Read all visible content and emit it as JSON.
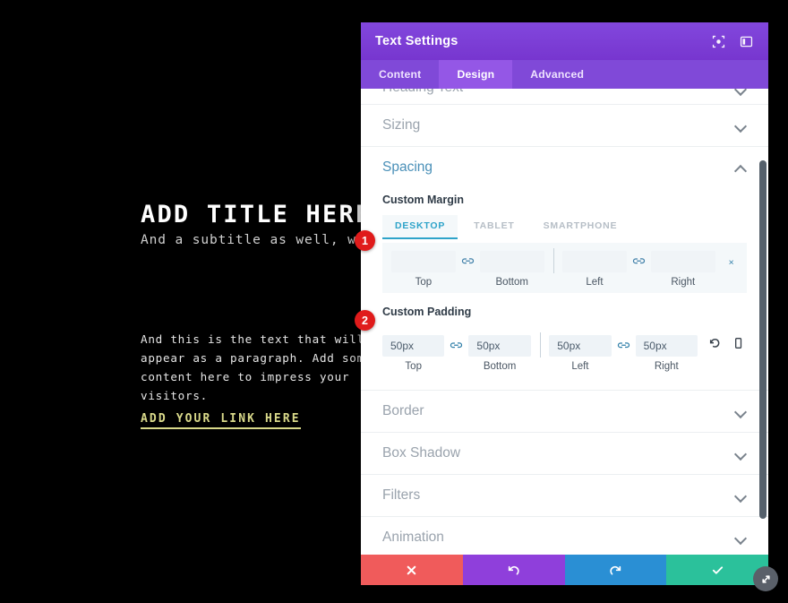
{
  "preview": {
    "title": "ADD TITLE HERE",
    "subtitle": "And a subtitle as well, why not",
    "paragraph": "And this is the text that will appear as a paragraph. Add some cool content here to impress your visitors.",
    "link": "ADD YOUR LINK HERE",
    "colors": {
      "background": "#000000",
      "title": "#ffffff",
      "link": "#d9d98a"
    }
  },
  "panel": {
    "header": {
      "title": "Text Settings",
      "icons": [
        {
          "name": "focus-target-icon"
        },
        {
          "name": "layout-panel-icon"
        }
      ],
      "color": "#7b3fd4"
    },
    "tabs": [
      {
        "label": "Content",
        "active": false
      },
      {
        "label": "Design",
        "active": true
      },
      {
        "label": "Advanced",
        "active": false
      }
    ],
    "sections": [
      {
        "label": "Heading Text",
        "open": false,
        "clipped": true
      },
      {
        "label": "Sizing",
        "open": false
      },
      {
        "label": "Spacing",
        "open": true
      },
      {
        "label": "Border",
        "open": false
      },
      {
        "label": "Box Shadow",
        "open": false
      },
      {
        "label": "Filters",
        "open": false
      },
      {
        "label": "Animation",
        "open": false
      }
    ],
    "spacing": {
      "margin": {
        "label": "Custom Margin",
        "device_tabs": [
          {
            "label": "DESKTOP",
            "active": true
          },
          {
            "label": "TABLET",
            "active": false
          },
          {
            "label": "SMARTPHONE",
            "active": false
          }
        ],
        "fields": [
          {
            "caption": "Top",
            "value": "",
            "placeholder": ""
          },
          {
            "caption": "Bottom",
            "value": "",
            "placeholder": ""
          },
          {
            "caption": "Left",
            "value": "",
            "placeholder": ""
          },
          {
            "caption": "Right",
            "value": "",
            "placeholder": ""
          }
        ]
      },
      "padding": {
        "label": "Custom Padding",
        "fields": [
          {
            "caption": "Top",
            "value": "50px"
          },
          {
            "caption": "Bottom",
            "value": "50px"
          },
          {
            "caption": "Left",
            "value": "50px"
          },
          {
            "caption": "Right",
            "value": "50px"
          }
        ]
      }
    },
    "actions": [
      {
        "name": "cancel-button",
        "icon": "x-icon",
        "color": "#f05b5b"
      },
      {
        "name": "undo-button",
        "icon": "undo-icon",
        "color": "#8f3fdb"
      },
      {
        "name": "redo-button",
        "icon": "redo-icon",
        "color": "#2a8fd4"
      },
      {
        "name": "save-button",
        "icon": "check-icon",
        "color": "#2bc19b"
      }
    ]
  },
  "annotations": [
    {
      "number": "1"
    },
    {
      "number": "2"
    }
  ]
}
